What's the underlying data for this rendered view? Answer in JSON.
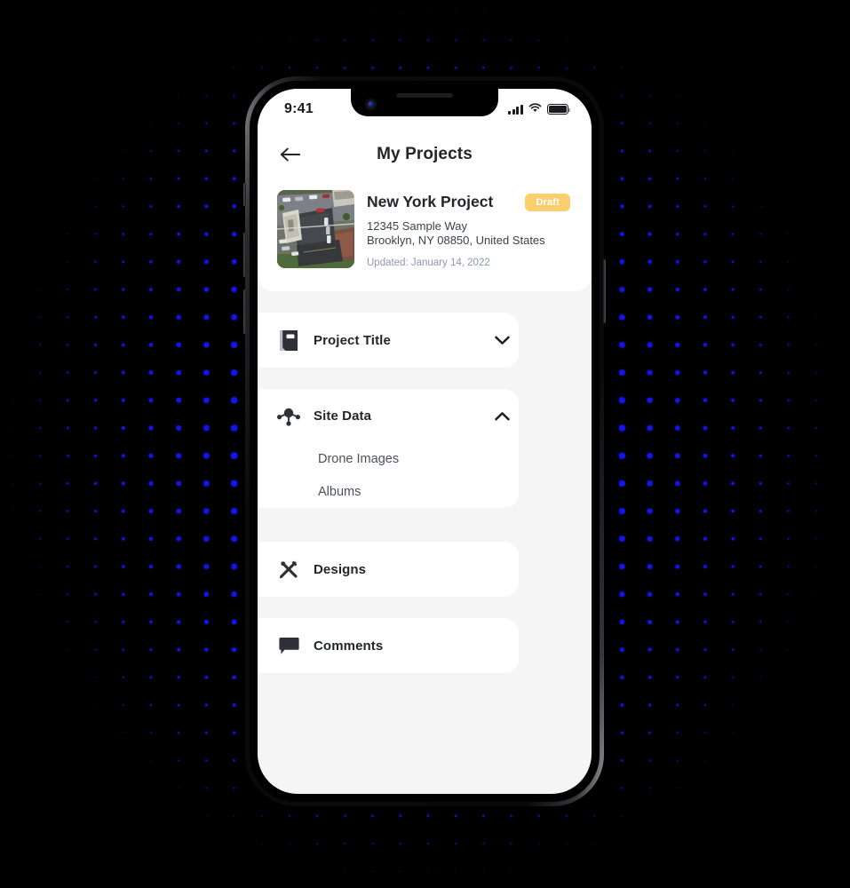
{
  "status_bar": {
    "time": "9:41",
    "cellular_icon": "signal-bars-icon",
    "wifi_icon": "wifi-icon",
    "battery_icon": "battery-full-icon"
  },
  "nav": {
    "back_icon": "back-arrow-icon",
    "title": "My Projects"
  },
  "project": {
    "thumbnail_alt": "aerial-drone-photo-of-building-and-parking-lot",
    "name": "New York Project",
    "status": "Draft",
    "status_color": "#FBCE70",
    "address_line1": "12345 Sample Way",
    "address_line2": "Brooklyn, NY 08850, United States",
    "updated": "Updated: January 14, 2022"
  },
  "menu": [
    {
      "id": "project-title",
      "label": "Project Title",
      "icon": "notebook-icon",
      "chevron": "chevron-down-icon",
      "expanded": false,
      "children": []
    },
    {
      "id": "site-data",
      "label": "Site Data",
      "icon": "network-hub-icon",
      "chevron": "chevron-up-icon",
      "expanded": true,
      "children": [
        "Drone Images",
        "Albums"
      ]
    },
    {
      "id": "designs",
      "label": "Designs",
      "icon": "pencil-ruler-icon",
      "chevron": null,
      "expanded": false,
      "children": []
    },
    {
      "id": "comments",
      "label": "Comments",
      "icon": "speech-bubble-icon",
      "chevron": null,
      "expanded": false,
      "children": []
    }
  ],
  "theme": {
    "background": "#000000",
    "dot_color": "#1414F0",
    "screen_background": "#F5F5F5",
    "card_background": "#FFFFFF",
    "text_primary": "#22252B",
    "text_muted": "#8E97AE"
  }
}
